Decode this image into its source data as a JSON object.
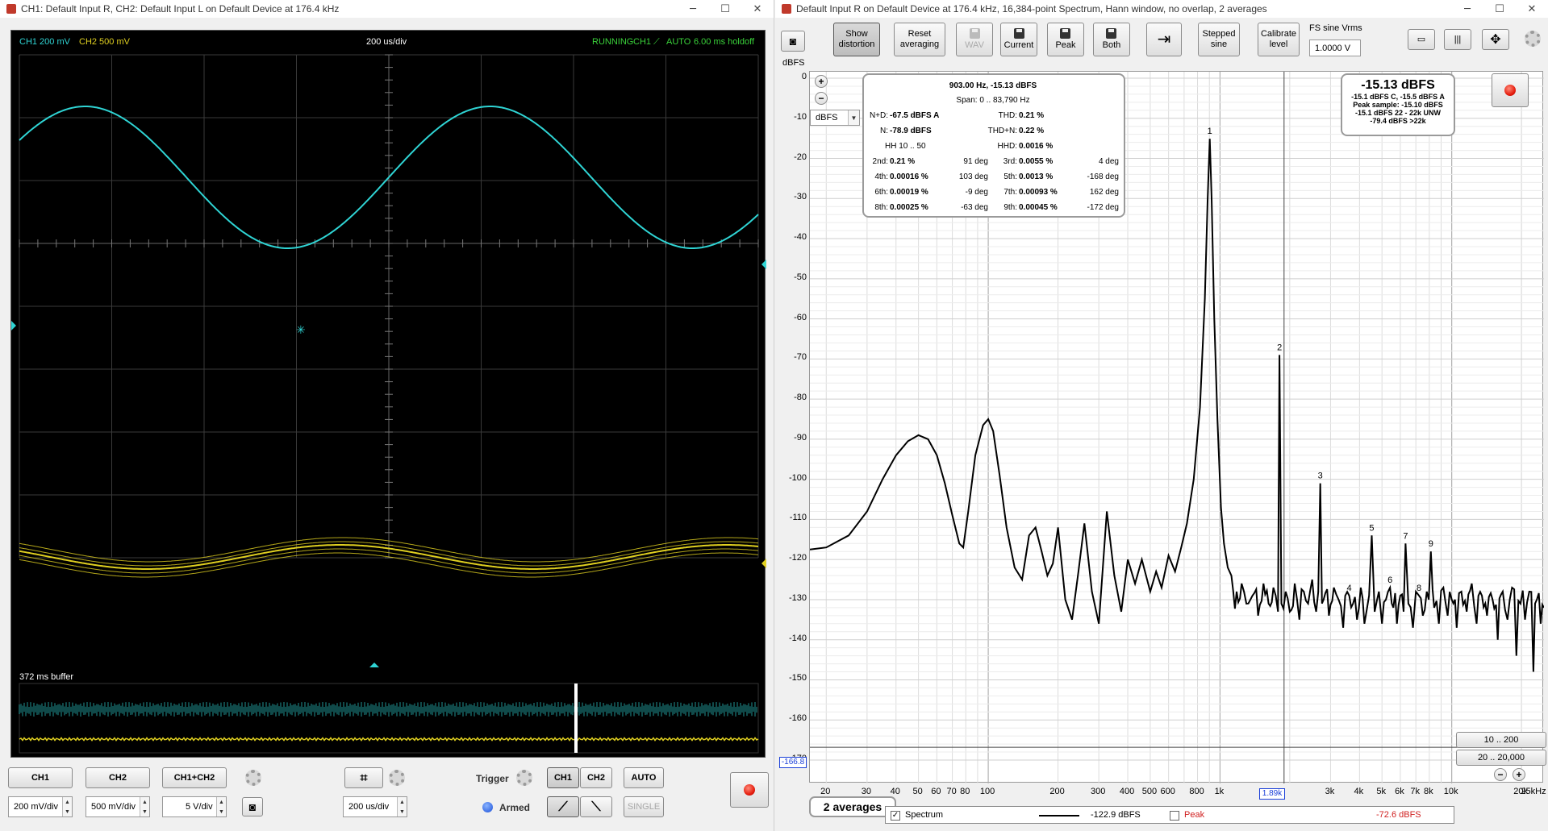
{
  "scope": {
    "title": "CH1: Default Input R, CH2: Default Input L on Default Device at 176.4 kHz",
    "ch1_scale": "CH1 200 mV",
    "ch2_scale": "CH2 500 mV",
    "timebase": "200 us/div",
    "status": "RUNNING",
    "trigger_channel": "CH1",
    "trigger_edge_icon": "rising-edge-icon",
    "trigger_mode": "AUTO",
    "holdoff": "6.00 ms holdoff",
    "buffer_label": "372 ms buffer",
    "ch1_color": "#2fd4d4",
    "ch2_color": "#e0d020",
    "controls": {
      "ch1_button": "CH1",
      "ch2_button": "CH2",
      "ch1ch2_button": "CH1+CH2",
      "ch1_vdiv": "200 mV/div",
      "ch2_vdiv": "500 mV/div",
      "ch12_vdiv": "5 V/div",
      "timebase_value": "200 us/div",
      "trigger_label": "Trigger",
      "armed_label": "Armed",
      "trig_ch1": "CH1",
      "trig_ch2": "CH2",
      "auto_button": "AUTO",
      "single_button": "SINGLE"
    }
  },
  "rta": {
    "title": "Default Input R on Default Device at 176.4 kHz, 16,384-point Spectrum, Hann window, no overlap, 2 averages",
    "toolbar": {
      "show_distortion": "Show distortion",
      "reset_averaging": "Reset averaging",
      "wav": "WAV",
      "current": "Current",
      "peak": "Peak",
      "both": "Both",
      "stepped_sine": "Stepped sine",
      "calibrate_level": "Calibrate level",
      "fs_label": "FS sine Vrms",
      "fs_value": "1.0000 V"
    },
    "y_unit_label": "dBFS",
    "unit_select": "dBFS",
    "cursor_marker": "-166.8",
    "freq_marker": "1.89k",
    "averages_badge": "2 averages",
    "range_buttons": [
      "10 .. 200",
      "20 .. 20,000"
    ],
    "distortion": {
      "header": "903.00 Hz, -15.13 dBFS",
      "span": "Span: 0 .. 83,790 Hz",
      "nd_label": "N+D:",
      "nd_value": "-67.5 dBFS A",
      "n_label": "N:",
      "n_value": "-78.9 dBFS",
      "hh_label": "HH 10 .. 50",
      "thd_label": "THD:",
      "thd_value": "0.21 %",
      "thdn_label": "THD+N:",
      "thdn_value": "0.22 %",
      "hhd_label": "HHD:",
      "hhd_value": "0.0016 %",
      "harmonics": [
        {
          "label": "2nd:",
          "value": "0.21 %",
          "phase": "91 deg"
        },
        {
          "label": "3rd:",
          "value": "0.0055 %",
          "phase": "4 deg"
        },
        {
          "label": "4th:",
          "value": "0.00016 %",
          "phase": "103 deg"
        },
        {
          "label": "5th:",
          "value": "0.0013 %",
          "phase": "-168 deg"
        },
        {
          "label": "6th:",
          "value": "0.00019 %",
          "phase": "-9 deg"
        },
        {
          "label": "7th:",
          "value": "0.00093 %",
          "phase": "162 deg"
        },
        {
          "label": "8th:",
          "value": "0.00025 %",
          "phase": "-63 deg"
        },
        {
          "label": "9th:",
          "value": "0.00045 %",
          "phase": "-172 deg"
        }
      ]
    },
    "level": {
      "main": "-15.13 dBFS",
      "line1": "-15.1 dBFS C, -15.5 dBFS A",
      "line2": "Peak sample: -15.10 dBFS",
      "line3": "-15.1 dBFS 22 - 22k UNW",
      "line4": "-79.4 dBFS >22k"
    },
    "legend": {
      "spectrum_label": "Spectrum",
      "spectrum_value": "-122.9 dBFS",
      "peak_label": "Peak",
      "peak_value": "-72.6 dBFS",
      "peak_color": "#d02020"
    }
  },
  "chart_data": {
    "type": "line",
    "title": "",
    "xlabel": "",
    "ylabel": "dBFS",
    "x_scale": "log",
    "xlim": [
      17,
      25000
    ],
    "ylim": [
      -170,
      0
    ],
    "yticks": [
      0,
      -10,
      -20,
      -30,
      -40,
      -50,
      -60,
      -70,
      -80,
      -90,
      -100,
      -110,
      -120,
      -130,
      -140,
      -150,
      -160,
      -170
    ],
    "xticks": [
      {
        "v": 20,
        "t": "20"
      },
      {
        "v": 30,
        "t": "30"
      },
      {
        "v": 40,
        "t": "40"
      },
      {
        "v": 50,
        "t": "50"
      },
      {
        "v": 60,
        "t": "60"
      },
      {
        "v": 70,
        "t": "70"
      },
      {
        "v": 80,
        "t": "80"
      },
      {
        "v": 100,
        "t": "100"
      },
      {
        "v": 200,
        "t": "200"
      },
      {
        "v": 300,
        "t": "300"
      },
      {
        "v": 400,
        "t": "400"
      },
      {
        "v": 500,
        "t": "500"
      },
      {
        "v": 600,
        "t": "600"
      },
      {
        "v": 800,
        "t": "800"
      },
      {
        "v": 1000,
        "t": "1k"
      },
      {
        "v": 3000,
        "t": "3k"
      },
      {
        "v": 4000,
        "t": "4k"
      },
      {
        "v": 5000,
        "t": "5k"
      },
      {
        "v": 6000,
        "t": "6k"
      },
      {
        "v": 7000,
        "t": "7k"
      },
      {
        "v": 8000,
        "t": "8k"
      },
      {
        "v": 10000,
        "t": "10k"
      },
      {
        "v": 20000,
        "t": "20k"
      },
      {
        "v": 25000,
        "t": "25kHz"
      }
    ],
    "series": [
      {
        "name": "Spectrum",
        "color": "#000000",
        "points": [
          [
            17,
            -117.5
          ],
          [
            20,
            -117
          ],
          [
            25,
            -114
          ],
          [
            30,
            -108
          ],
          [
            35,
            -100
          ],
          [
            40,
            -94
          ],
          [
            45,
            -90.5
          ],
          [
            50,
            -89
          ],
          [
            55,
            -90
          ],
          [
            60,
            -94
          ],
          [
            65,
            -101
          ],
          [
            70,
            -109
          ],
          [
            75,
            -116
          ],
          [
            78,
            -117
          ],
          [
            82,
            -108
          ],
          [
            88,
            -94
          ],
          [
            95,
            -86.5
          ],
          [
            100,
            -85
          ],
          [
            105,
            -88
          ],
          [
            112,
            -99
          ],
          [
            120,
            -112
          ],
          [
            130,
            -122
          ],
          [
            140,
            -125
          ],
          [
            150,
            -114
          ],
          [
            160,
            -112
          ],
          [
            170,
            -118
          ],
          [
            180,
            -124
          ],
          [
            190,
            -121
          ],
          [
            200,
            -112
          ],
          [
            215,
            -130
          ],
          [
            230,
            -135
          ],
          [
            245,
            -123
          ],
          [
            260,
            -111
          ],
          [
            280,
            -128
          ],
          [
            300,
            -136
          ],
          [
            325,
            -108
          ],
          [
            350,
            -124
          ],
          [
            375,
            -133
          ],
          [
            400,
            -120
          ],
          [
            430,
            -126
          ],
          [
            460,
            -120
          ],
          [
            500,
            -128
          ],
          [
            530,
            -123
          ],
          [
            560,
            -127
          ],
          [
            600,
            -119
          ],
          [
            640,
            -123
          ],
          [
            680,
            -117
          ],
          [
            720,
            -111
          ],
          [
            770,
            -100
          ],
          [
            820,
            -82
          ],
          [
            860,
            -55
          ],
          [
            885,
            -30
          ],
          [
            903,
            -15.1
          ],
          [
            920,
            -30
          ],
          [
            945,
            -60
          ],
          [
            975,
            -85
          ],
          [
            1010,
            -107
          ],
          [
            1040,
            -116
          ],
          [
            1080,
            -122
          ],
          [
            1120,
            -124
          ],
          [
            1180,
            -128
          ],
          [
            1240,
            -126
          ],
          [
            1300,
            -131
          ],
          [
            1380,
            -129
          ],
          [
            1460,
            -134
          ],
          [
            1540,
            -126
          ],
          [
            1620,
            -131
          ],
          [
            1700,
            -127
          ],
          [
            1780,
            -133
          ],
          [
            1806,
            -69
          ],
          [
            1840,
            -131
          ],
          [
            1920,
            -128
          ],
          [
            2000,
            -133
          ],
          [
            2100,
            -126
          ],
          [
            2200,
            -135
          ],
          [
            2300,
            -128
          ],
          [
            2400,
            -131
          ],
          [
            2500,
            -125
          ],
          [
            2600,
            -133
          ],
          [
            2709,
            -101
          ],
          [
            2800,
            -130
          ],
          [
            2950,
            -134
          ],
          [
            3100,
            -127
          ],
          [
            3250,
            -130
          ],
          [
            3400,
            -137
          ],
          [
            3612,
            -129
          ],
          [
            3750,
            -131
          ],
          [
            3900,
            -135
          ],
          [
            4050,
            -127
          ],
          [
            4200,
            -136
          ],
          [
            4400,
            -129
          ],
          [
            4515,
            -114
          ],
          [
            4650,
            -133
          ],
          [
            4850,
            -128
          ],
          [
            5000,
            -136
          ],
          [
            5200,
            -130
          ],
          [
            5418,
            -127
          ],
          [
            5600,
            -132
          ],
          [
            5800,
            -136
          ],
          [
            6000,
            -129
          ],
          [
            6200,
            -133
          ],
          [
            6321,
            -116
          ],
          [
            6500,
            -131
          ],
          [
            6800,
            -137
          ],
          [
            7000,
            -128
          ],
          [
            7224,
            -129
          ],
          [
            7500,
            -134
          ],
          [
            7800,
            -128
          ],
          [
            8127,
            -118
          ],
          [
            8400,
            -132
          ],
          [
            8800,
            -136
          ],
          [
            9200,
            -127
          ],
          [
            9600,
            -134
          ],
          [
            10000,
            -130
          ],
          [
            10500,
            -137
          ],
          [
            11000,
            -128
          ],
          [
            11600,
            -133
          ],
          [
            12200,
            -126
          ],
          [
            12800,
            -136
          ],
          [
            13500,
            -129
          ],
          [
            14200,
            -134
          ],
          [
            15000,
            -130
          ],
          [
            15800,
            -140
          ],
          [
            16600,
            -128
          ],
          [
            17400,
            -135
          ],
          [
            18200,
            -127
          ],
          [
            19000,
            -144
          ],
          [
            19800,
            -131
          ],
          [
            20700,
            -135
          ],
          [
            21600,
            -128
          ],
          [
            22500,
            -148
          ],
          [
            23300,
            -130
          ],
          [
            24200,
            -136
          ],
          [
            25000,
            -132
          ]
        ]
      }
    ],
    "harmonic_markers": [
      {
        "n": "1",
        "f": 903,
        "db": -15.1
      },
      {
        "n": "2",
        "f": 1806,
        "db": -69
      },
      {
        "n": "3",
        "f": 2709,
        "db": -101
      },
      {
        "n": "4",
        "f": 3612,
        "db": -129
      },
      {
        "n": "5",
        "f": 4515,
        "db": -114
      },
      {
        "n": "6",
        "f": 5418,
        "db": -127
      },
      {
        "n": "7",
        "f": 6321,
        "db": -116
      },
      {
        "n": "8",
        "f": 7224,
        "db": -129
      },
      {
        "n": "9",
        "f": 8127,
        "db": -118
      }
    ]
  }
}
